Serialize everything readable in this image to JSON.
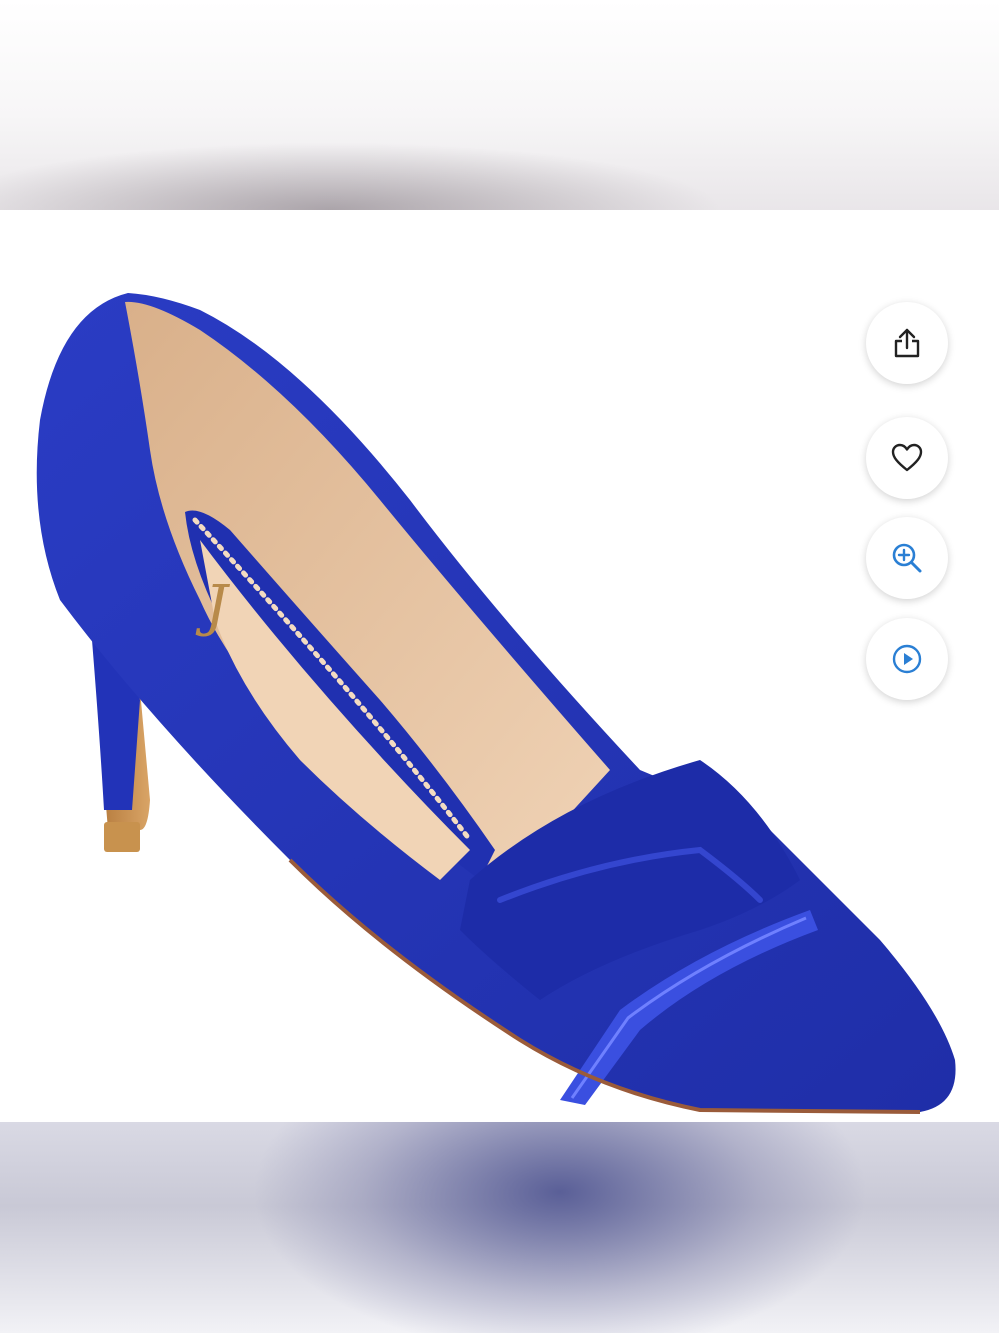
{
  "page": {
    "background": "#ffffff"
  },
  "product": {
    "image_icon": "blue-pointed-toe-pump-image",
    "colors": {
      "suede": "#2233b8",
      "suede_dark": "#1a2796",
      "lining": "#e8c4a0",
      "heel": "#c8924e",
      "band": "#3a4fe0"
    }
  },
  "actions": [
    {
      "id": "share",
      "icon": "share-icon",
      "color": "#222222"
    },
    {
      "id": "favorite",
      "icon": "heart-icon",
      "color": "#222222"
    },
    {
      "id": "zoom",
      "icon": "zoom-in-icon",
      "color": "#2a7fd4"
    },
    {
      "id": "video",
      "icon": "play-icon",
      "color": "#2a7fd4"
    }
  ]
}
